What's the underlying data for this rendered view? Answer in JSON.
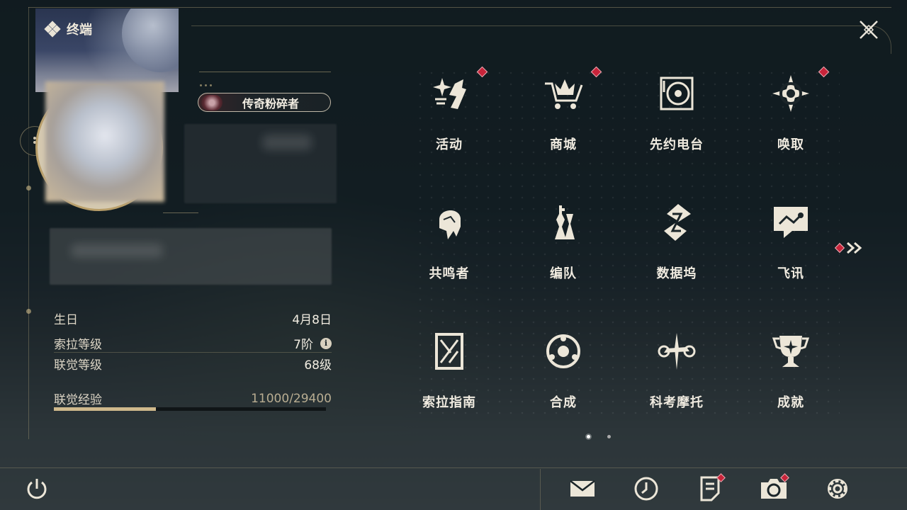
{
  "header": {
    "title": "终端",
    "icon": "diamond-cluster-icon"
  },
  "profile": {
    "title_badge": "传奇粉碎者",
    "stats": [
      {
        "label": "生日",
        "value": "4月8日"
      },
      {
        "label": "索拉等级",
        "value": "7阶",
        "info": "i"
      },
      {
        "label": "联觉等级",
        "value": "68级"
      }
    ],
    "xp": {
      "label": "联觉经验",
      "value": "11000/29400",
      "current": 11000,
      "max": 29400,
      "fraction": 0.374
    }
  },
  "menu": [
    {
      "label": "活动",
      "icon": "sparkle-burst-icon",
      "badge": true
    },
    {
      "label": "商城",
      "icon": "shopping-cart-icon",
      "badge": true
    },
    {
      "label": "先约电台",
      "icon": "radio-record-icon",
      "badge": false
    },
    {
      "label": "唤取",
      "icon": "compass-star-icon",
      "badge": true
    },
    {
      "label": "共鸣者",
      "icon": "character-portrait-icon",
      "badge": false
    },
    {
      "label": "编队",
      "icon": "chess-pieces-icon",
      "badge": false
    },
    {
      "label": "数据坞",
      "icon": "data-dock-icon",
      "badge": false
    },
    {
      "label": "飞讯",
      "icon": "chat-bubble-icon",
      "badge": false
    },
    {
      "label": "索拉指南",
      "icon": "guidebook-icon",
      "badge": false
    },
    {
      "label": "合成",
      "icon": "synthesis-orb-icon",
      "badge": false
    },
    {
      "label": "科考摩托",
      "icon": "motorbike-icon",
      "badge": false
    },
    {
      "label": "成就",
      "icon": "trophy-icon",
      "badge": false
    }
  ],
  "pager": {
    "current": 1,
    "total": 2
  },
  "colors": {
    "accent": "#cfb98c",
    "badge": "#c8243a",
    "text": "#f0ebe0"
  }
}
